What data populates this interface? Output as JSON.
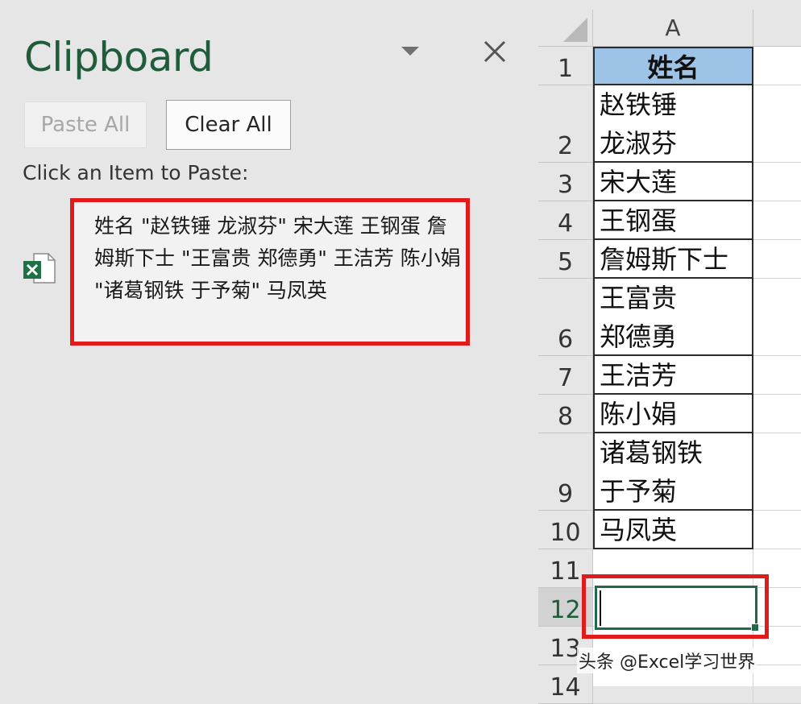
{
  "clipboard_pane": {
    "title": "Clipboard",
    "paste_all_label": "Paste All",
    "clear_all_label": "Clear All",
    "hint": "Click an Item to Paste:",
    "item": {
      "icon": "excel-file-icon",
      "text": "姓名 \"赵铁锤 龙淑芬\" 宋大莲 王钢蛋 詹姆斯下士 \"王富贵 郑德勇\" 王洁芳 陈小娟 \"诸葛钢铁 于予菊\" 马凤英"
    },
    "colors": {
      "title": "#1e5c3a",
      "highlight": "#e01b1b"
    }
  },
  "sheet": {
    "column_header": "A",
    "rows": [
      {
        "num": "1",
        "value": "姓名"
      },
      {
        "num": "2",
        "value": "赵铁锤 龙淑芬"
      },
      {
        "num": "3",
        "value": "宋大莲"
      },
      {
        "num": "4",
        "value": "王钢蛋"
      },
      {
        "num": "5",
        "value": "詹姆斯下士"
      },
      {
        "num": "6",
        "value": "王富贵 郑德勇"
      },
      {
        "num": "7",
        "value": "王洁芳"
      },
      {
        "num": "8",
        "value": "陈小娟"
      },
      {
        "num": "9",
        "value": "诸葛钢铁 于予菊"
      },
      {
        "num": "10",
        "value": "马凤英"
      },
      {
        "num": "11",
        "value": ""
      },
      {
        "num": "12",
        "value": ""
      },
      {
        "num": "13",
        "value": ""
      },
      {
        "num": "14",
        "value": ""
      }
    ],
    "active_row": "12",
    "colors": {
      "header_fill": "#9dc3e6",
      "selection": "#1e6b47"
    }
  },
  "watermark": "头条 @Excel学习世界"
}
